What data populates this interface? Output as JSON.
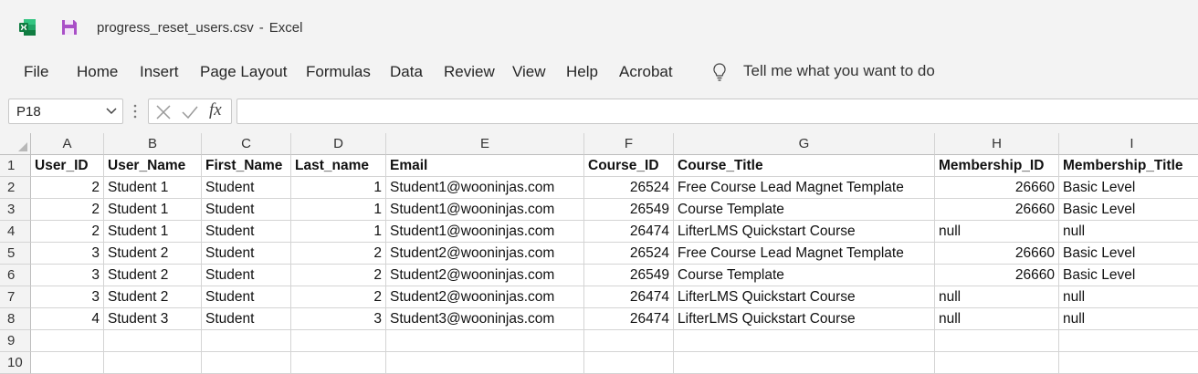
{
  "window": {
    "file_name": "progress_reset_users.csv",
    "separator": "-",
    "app_name": "Excel"
  },
  "ribbon": {
    "tabs": [
      "File",
      "Home",
      "Insert",
      "Page Layout",
      "Formulas",
      "Data",
      "Review",
      "View",
      "Help",
      "Acrobat"
    ],
    "tell_me": "Tell me what you want to do"
  },
  "formula_bar": {
    "name_box": "P18",
    "fx_label": "fx",
    "formula": ""
  },
  "sheet": {
    "columns": [
      "A",
      "B",
      "C",
      "D",
      "E",
      "F",
      "G",
      "H",
      "I"
    ],
    "row_numbers": [
      "1",
      "2",
      "3",
      "4",
      "5",
      "6",
      "7",
      "8",
      "9",
      "10"
    ],
    "numeric_columns": [
      0,
      3,
      5,
      7
    ],
    "rows": [
      [
        "User_ID",
        "User_Name",
        "First_Name",
        "Last_name",
        "Email",
        "Course_ID",
        "Course_Title",
        "Membership_ID",
        "Membership_Title"
      ],
      [
        "2",
        "Student 1",
        "Student",
        "1",
        "Student1@wooninjas.com",
        "26524",
        "Free Course Lead Magnet Template",
        "26660",
        "Basic Level"
      ],
      [
        "2",
        "Student 1",
        "Student",
        "1",
        "Student1@wooninjas.com",
        "26549",
        "Course Template",
        "26660",
        "Basic Level"
      ],
      [
        "2",
        "Student 1",
        "Student",
        "1",
        "Student1@wooninjas.com",
        "26474",
        "LifterLMS Quickstart Course",
        "null",
        "null"
      ],
      [
        "3",
        "Student 2",
        "Student",
        "2",
        "Student2@wooninjas.com",
        "26524",
        "Free Course Lead Magnet Template",
        "26660",
        "Basic Level"
      ],
      [
        "3",
        "Student 2",
        "Student",
        "2",
        "Student2@wooninjas.com",
        "26549",
        "Course Template",
        "26660",
        "Basic Level"
      ],
      [
        "3",
        "Student 2",
        "Student",
        "2",
        "Student2@wooninjas.com",
        "26474",
        "LifterLMS Quickstart Course",
        "null",
        "null"
      ],
      [
        "4",
        "Student 3",
        "Student",
        "3",
        "Student3@wooninjas.com",
        "26474",
        "LifterLMS Quickstart Course",
        "null",
        "null"
      ],
      [
        "",
        "",
        "",
        "",
        "",
        "",
        "",
        "",
        ""
      ],
      [
        "",
        "",
        "",
        "",
        "",
        "",
        "",
        "",
        ""
      ]
    ]
  },
  "colors": {
    "excel_green": "#107c41",
    "save_purple": "#a94fc7",
    "chrome_bg": "#f3f3f3",
    "gridline": "#d4d4d4"
  }
}
